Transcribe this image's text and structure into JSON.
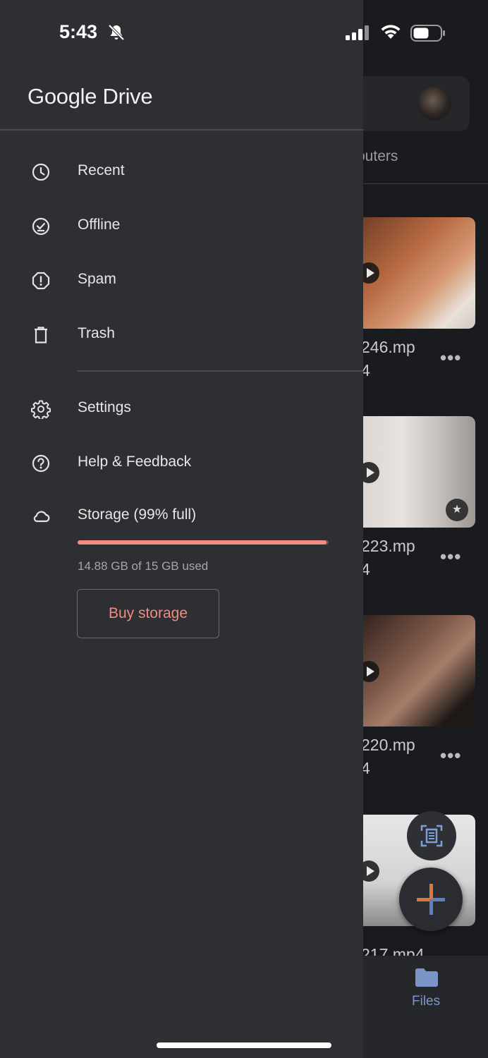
{
  "status_bar": {
    "time": "5:43"
  },
  "drawer": {
    "brand": "Google Drive",
    "items": [
      {
        "label": "Recent",
        "icon": "clock-icon"
      },
      {
        "label": "Offline",
        "icon": "offline-check-icon"
      },
      {
        "label": "Spam",
        "icon": "spam-icon"
      },
      {
        "label": "Trash",
        "icon": "trash-icon"
      }
    ],
    "secondary_items": [
      {
        "label": "Settings",
        "icon": "gear-icon"
      },
      {
        "label": "Help & Feedback",
        "icon": "help-icon"
      }
    ],
    "storage": {
      "label": "Storage (99% full)",
      "used_text": "14.88 GB of 15 GB used",
      "used_fraction": 0.992,
      "buy_label": "Buy storage",
      "accent_color": "#f28b82"
    }
  },
  "background": {
    "tab_partial": "outers",
    "files": [
      {
        "name_line1": "246.mp",
        "name_line2": "4"
      },
      {
        "name_line1": "223.mp",
        "name_line2": "4"
      },
      {
        "name_line1": "220.mp",
        "name_line2": "4"
      },
      {
        "name_line1": "217.mp4"
      }
    ],
    "more_label": "•••",
    "nav_files_label": "Files"
  }
}
